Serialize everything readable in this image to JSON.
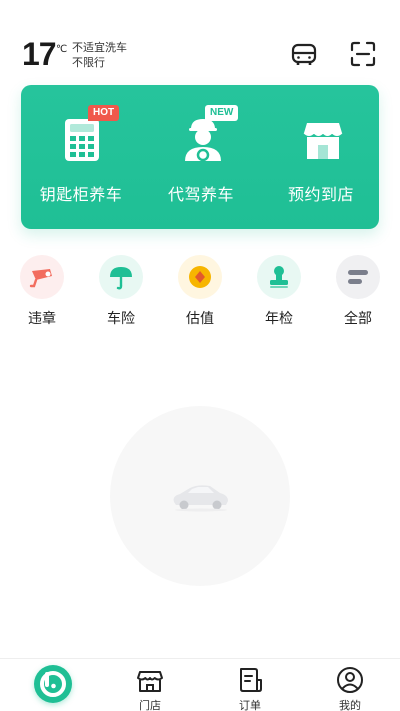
{
  "header": {
    "temperature": "17",
    "unit": "℃",
    "car_wash": "不适宜洗车",
    "traffic_limit": "不限行"
  },
  "services": [
    {
      "label": "钥匙柜养车",
      "badge": "HOT",
      "icon": "locker-icon"
    },
    {
      "label": "代驾养车",
      "badge": "NEW",
      "icon": "driver-icon"
    },
    {
      "label": "预约到店",
      "badge": "",
      "icon": "store-icon"
    }
  ],
  "tools": [
    {
      "label": "违章",
      "icon": "camera-icon",
      "bg": "#fdeeee"
    },
    {
      "label": "车险",
      "icon": "umbrella-icon",
      "bg": "#e8f8f3"
    },
    {
      "label": "估值",
      "icon": "coin-icon",
      "bg": "#fff6e0"
    },
    {
      "label": "年检",
      "icon": "stamp-icon",
      "bg": "#e8f8f3"
    },
    {
      "label": "全部",
      "icon": "all-icon",
      "bg": "#f0f0f2"
    }
  ],
  "tabbar": [
    {
      "label": "",
      "icon": "home-logo-icon"
    },
    {
      "label": "门店",
      "icon": "store-icon"
    },
    {
      "label": "订单",
      "icon": "order-icon"
    },
    {
      "label": "我的",
      "icon": "profile-icon"
    }
  ],
  "colors": {
    "brand": "#1fbf95",
    "hot_badge": "#f0584b"
  }
}
